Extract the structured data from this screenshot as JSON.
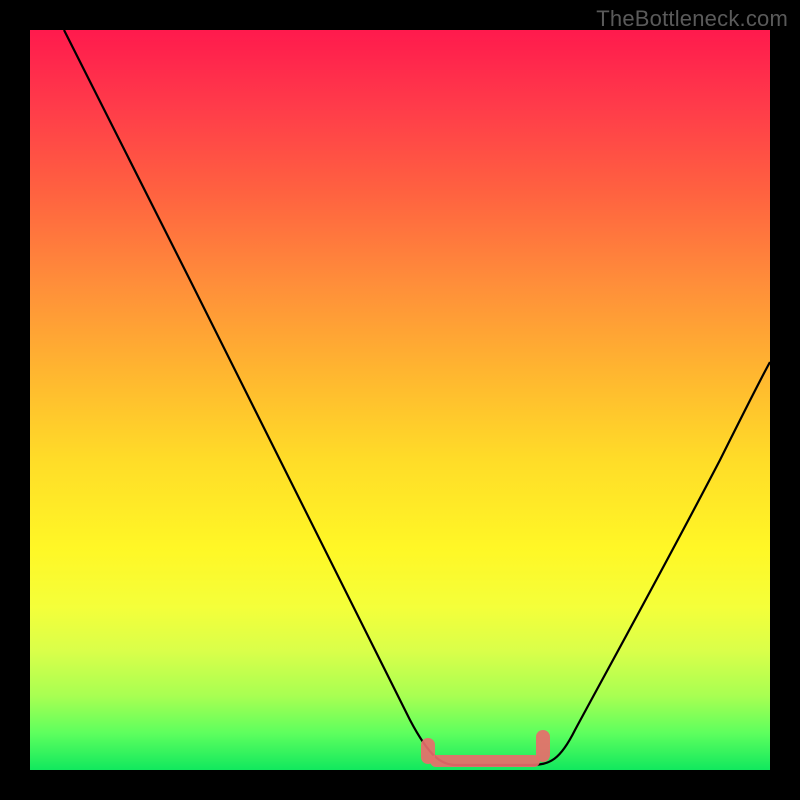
{
  "watermark": "TheBottleneck.com",
  "colors": {
    "bg": "#000000",
    "curve": "#000000",
    "accent": "#e26d6d"
  },
  "chart_data": {
    "type": "line",
    "title": "",
    "xlabel": "",
    "ylabel": "",
    "xlim": [
      0,
      100
    ],
    "ylim": [
      0,
      100
    ],
    "grid": false,
    "x": [
      0,
      5,
      10,
      15,
      20,
      25,
      30,
      35,
      40,
      45,
      50,
      55,
      57,
      60,
      65,
      70,
      75,
      80,
      85,
      90,
      95,
      100
    ],
    "values": [
      100,
      90,
      80,
      70,
      60,
      51,
      42,
      33,
      25,
      17,
      10,
      3,
      1,
      0,
      0,
      1,
      5,
      12,
      22,
      33,
      45,
      58
    ],
    "accent_band": {
      "x_start": 55,
      "x_end": 72,
      "note": "flat minimum region"
    },
    "background_gradient": [
      "#ff1a4d",
      "#ffdc28",
      "#11e85e"
    ]
  }
}
